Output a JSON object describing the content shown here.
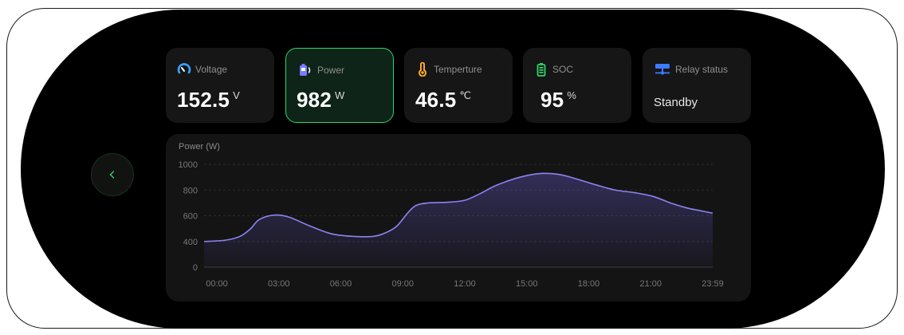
{
  "cards": [
    {
      "label": "Voltage",
      "value": "152.5",
      "unit": "V",
      "icon": "gauge-icon",
      "icon_color": "#3aa3ff"
    },
    {
      "label": "Power",
      "value": "982",
      "unit": "W",
      "icon": "battery-charge-icon",
      "icon_color": "#7b7bff",
      "active": true
    },
    {
      "label": "Temperture",
      "value": "46.5",
      "unit": "℃",
      "icon": "thermometer-icon",
      "icon_color": "#ffa726"
    },
    {
      "label": "SOC",
      "value": "95",
      "unit": "%",
      "icon": "battery-icon",
      "icon_color": "#2bd46a"
    },
    {
      "label": "Relay status",
      "status": "Standby",
      "icon": "relay-icon",
      "icon_color": "#3a7bff"
    }
  ],
  "colors": {
    "accent": "#2bd46a",
    "line": "#8d83f0"
  },
  "chart_data": {
    "type": "area",
    "title": "Power  (W)",
    "x_ticks": [
      "00:00",
      "03:00",
      "06:00",
      "09:00",
      "12:00",
      "15:00",
      "18:00",
      "21:00",
      "23:59"
    ],
    "y_ticks": [
      "0",
      "400",
      "600",
      "800",
      "1000"
    ],
    "ylim": [
      0,
      1000
    ],
    "points": [
      [
        0,
        400
      ],
      [
        1,
        410
      ],
      [
        1.7,
        440
      ],
      [
        2.2,
        500
      ],
      [
        2.6,
        570
      ],
      [
        3.3,
        605
      ],
      [
        4,
        590
      ],
      [
        5,
        520
      ],
      [
        6,
        460
      ],
      [
        7,
        440
      ],
      [
        8,
        440
      ],
      [
        8.6,
        470
      ],
      [
        9.1,
        520
      ],
      [
        9.6,
        620
      ],
      [
        10,
        680
      ],
      [
        10.6,
        700
      ],
      [
        11.5,
        705
      ],
      [
        12.3,
        720
      ],
      [
        13,
        770
      ],
      [
        13.7,
        830
      ],
      [
        14.5,
        880
      ],
      [
        15.3,
        915
      ],
      [
        16,
        930
      ],
      [
        16.8,
        920
      ],
      [
        17.5,
        890
      ],
      [
        18.5,
        840
      ],
      [
        19.4,
        800
      ],
      [
        20.3,
        780
      ],
      [
        21.2,
        750
      ],
      [
        22,
        700
      ],
      [
        22.8,
        660
      ],
      [
        23.4,
        640
      ],
      [
        24,
        620
      ]
    ],
    "grid": true
  }
}
